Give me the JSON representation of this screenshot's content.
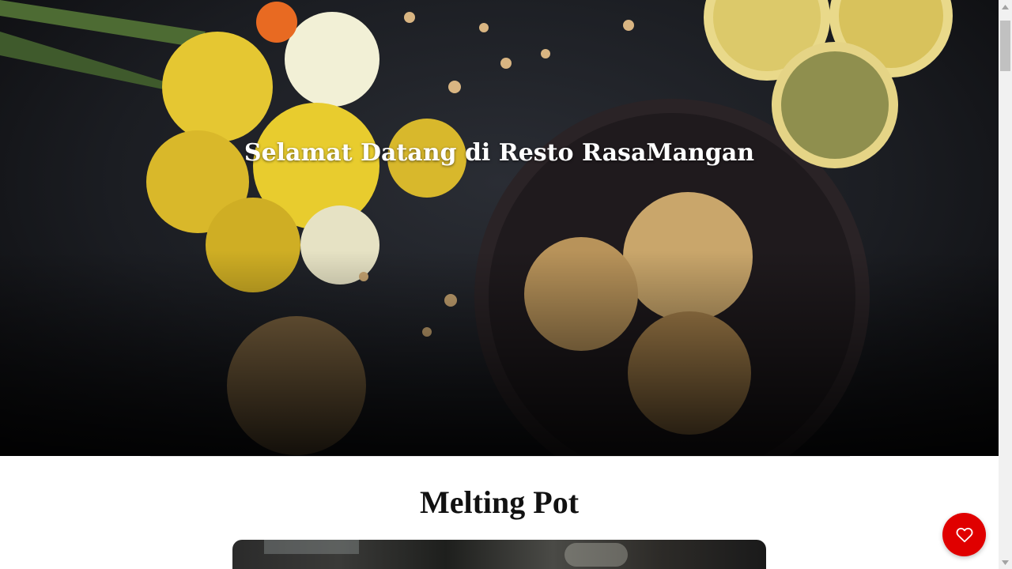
{
  "hero": {
    "title": "Selamat Datang di Resto RasaMangan",
    "image_icon": "hero-food-image"
  },
  "restaurants": {
    "first_name": "Melting Pot"
  },
  "fab": {
    "icon": "heart-icon",
    "color": "#e00000"
  },
  "scrollbar": {
    "up_icon": "arrow-up-icon",
    "down_icon": "arrow-down-icon"
  }
}
